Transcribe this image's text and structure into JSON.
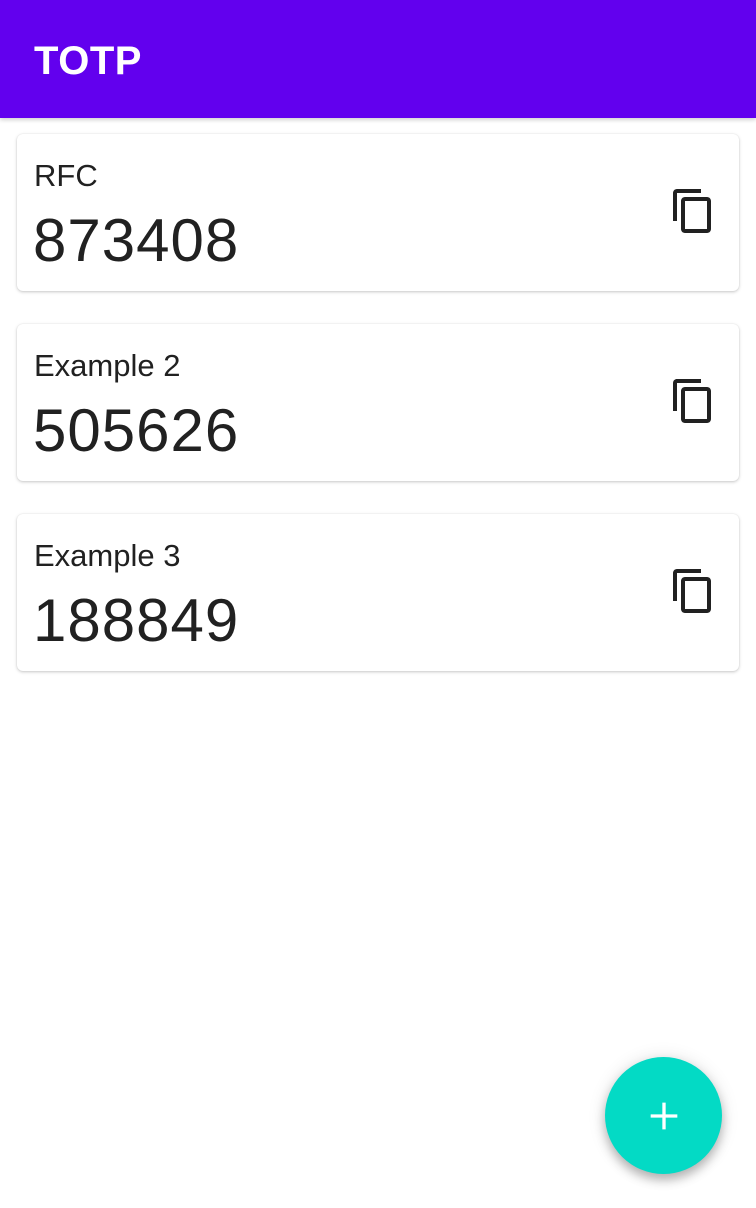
{
  "app_bar": {
    "title": "TOTP",
    "color": "#6200ee"
  },
  "accounts": [
    {
      "label": "RFC",
      "code": "873408",
      "action_icon": "copy-icon"
    },
    {
      "label": "Example 2",
      "code": "505626",
      "action_icon": "copy-icon"
    },
    {
      "label": "Example 3",
      "code": "188849",
      "action_icon": "copy-icon"
    }
  ],
  "fab": {
    "icon": "plus-icon",
    "color": "#03dac5"
  }
}
